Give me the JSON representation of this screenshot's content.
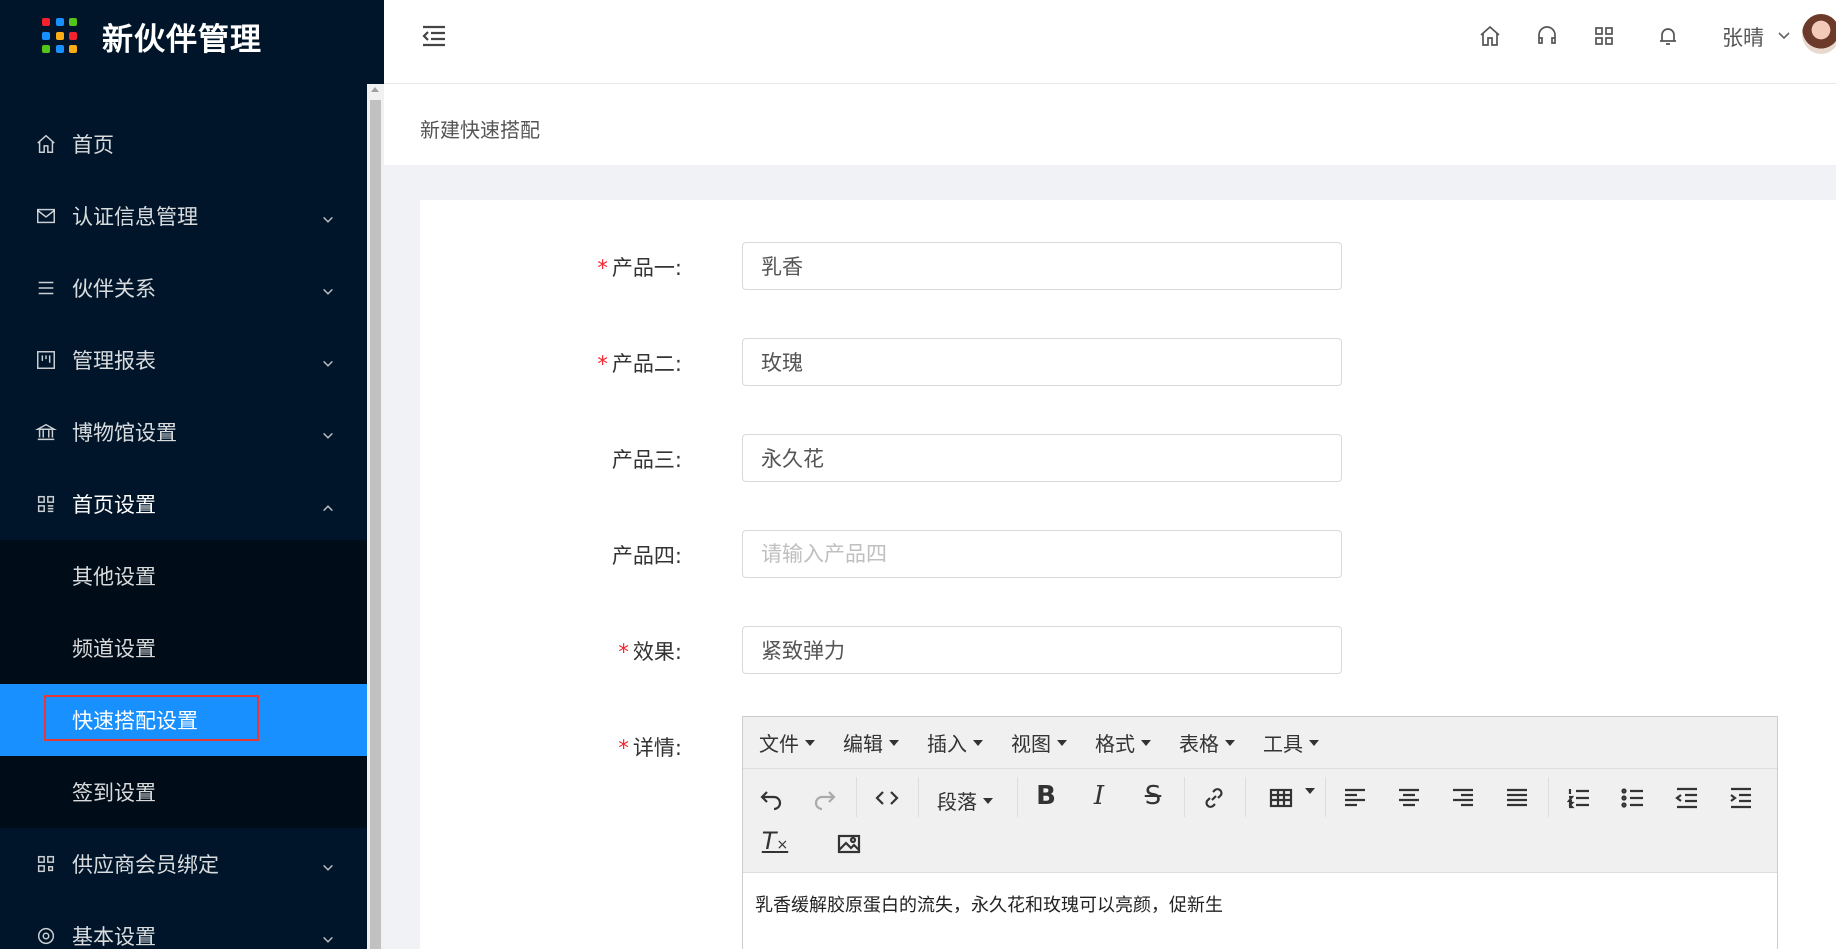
{
  "app": {
    "title": "新伙伴管理",
    "logo_colors": [
      "#f5222d",
      "#1890ff",
      "#52c41a",
      "#1890ff",
      "#faad14",
      "#f5222d",
      "#52c41a",
      "#1890ff",
      "#faad14"
    ]
  },
  "sidebar": {
    "items": [
      {
        "label": "首页",
        "icon": "home-icon"
      },
      {
        "label": "认证信息管理",
        "icon": "mail-icon"
      },
      {
        "label": "伙伴关系",
        "icon": "list-icon"
      },
      {
        "label": "管理报表",
        "icon": "report-icon"
      },
      {
        "label": "博物馆设置",
        "icon": "bank-icon"
      },
      {
        "label": "首页设置",
        "icon": "appstore-icon"
      }
    ],
    "submenu": [
      {
        "label": "其他设置"
      },
      {
        "label": "频道设置"
      },
      {
        "label": "快速搭配设置"
      },
      {
        "label": "签到设置"
      }
    ],
    "items_after": [
      {
        "label": "供应商会员绑定",
        "icon": "qrcode-icon"
      },
      {
        "label": "基本设置",
        "icon": "setting-icon"
      }
    ]
  },
  "header": {
    "user_name": "张晴"
  },
  "tab": {
    "title": "新建快速搭配"
  },
  "form": {
    "product1": {
      "label": "产品一:",
      "value": "乳香",
      "required": true
    },
    "product2": {
      "label": "产品二:",
      "value": "玫瑰",
      "required": true
    },
    "product3": {
      "label": "产品三:",
      "value": "永久花",
      "required": false
    },
    "product4": {
      "label": "产品四:",
      "value": "",
      "placeholder": "请输入产品四",
      "required": false
    },
    "effect": {
      "label": "效果:",
      "value": "紧致弹力",
      "required": true
    },
    "detail": {
      "label": "详情:",
      "required": true
    },
    "required_mark": "*"
  },
  "editor": {
    "menus": [
      "文件",
      "编辑",
      "插入",
      "视图",
      "格式",
      "表格",
      "工具"
    ],
    "paragraph_label": "段落",
    "content": "乳香缓解胶原蛋白的流失，永久花和玫瑰可以亮颜，促新生"
  }
}
